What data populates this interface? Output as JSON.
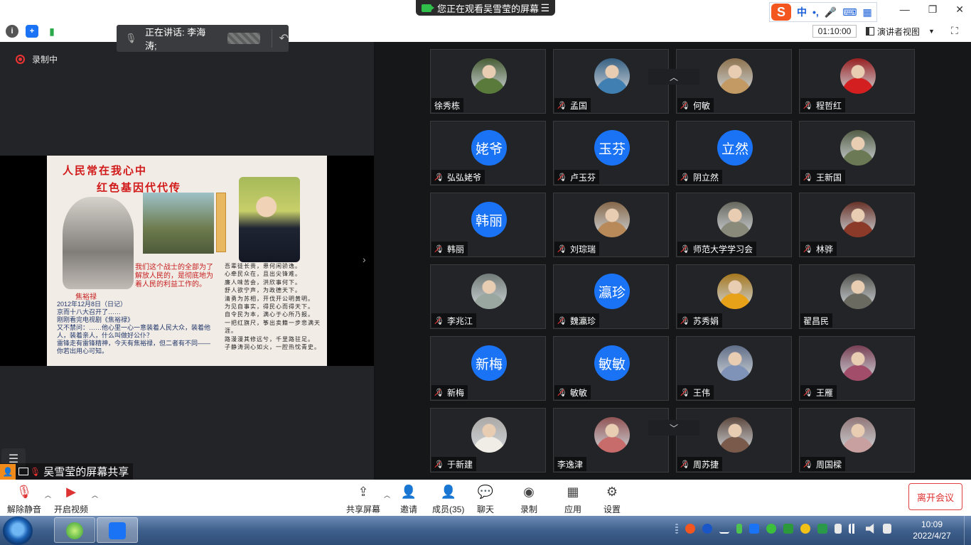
{
  "top": {
    "share_banner": "您正在观看吴雪莹的屏幕",
    "banner_menu": "☰",
    "speaking_label": "正在讲话: 李海涛;",
    "timer": "01:10:00",
    "presenter_view": "演讲者视图",
    "ime_label": "中",
    "win_min": "—",
    "win_restore": "❐",
    "win_close": "✕"
  },
  "left": {
    "recording": "录制中",
    "share_label": "吴雪莹的屏幕共享",
    "slide": {
      "title1": "人民常在我心中",
      "title2": "红色基因代代传",
      "red_text": "我们这个战士的全部为了解放人民的，是彻底地为着人民的利益工作的。",
      "sign": "焦裕禄",
      "diary": "2012年12月8日（日记）\n京而十八大召开了……\n刚刚看完电视剧《焦裕禄》\n又不禁问：……他心里一心一意装着人民大众，装着他人，装着亲人，什么叫做好公仆？\n雷锋走有雷锋精神，今天有焦裕禄，但二者有不同——你若出用心可知。",
      "poem": "吾辈徒长贵，患何闲骄逸。\n心牵民众在，且出尖锋难。\n廉人味苦会，洪欣事何下。\n舒人欲宁声，为政德天下。\n清勇为苏相，开伐开公明黄明。\n为见自事实，得民心而得天下。\n自令民为本，满心于心所乃报。\n一把红旗尺，筝出卖籍一步悲满天涯。\n路漫漫其修远兮，千里路驻足。\n子静涛洞心如火，一腔热忱青史。"
    }
  },
  "gallery": [
    {
      "name": "徐秀栋",
      "initials": "",
      "muted": false,
      "color": "#5a7a3c"
    },
    {
      "name": "孟国",
      "initials": "",
      "muted": true,
      "color": "#3f7fb2"
    },
    {
      "name": "何敏",
      "initials": "",
      "muted": true,
      "color": "#c39a63"
    },
    {
      "name": "程哲红",
      "initials": "",
      "muted": true,
      "color": "#d31f1f"
    },
    {
      "name": "弘弘姥爷",
      "initials": "姥爷",
      "muted": true,
      "color": "#1a73f5"
    },
    {
      "name": "卢玉芬",
      "initials": "玉芬",
      "muted": true,
      "color": "#1a73f5"
    },
    {
      "name": "阴立然",
      "initials": "立然",
      "muted": true,
      "color": "#1a73f5"
    },
    {
      "name": "王新国",
      "initials": "",
      "muted": true,
      "color": "#6b7a55"
    },
    {
      "name": "韩丽",
      "initials": "韩丽",
      "muted": true,
      "color": "#1a73f5"
    },
    {
      "name": "刘琮瑞",
      "initials": "",
      "muted": true,
      "color": "#b88a5a"
    },
    {
      "name": "师范大学学习会",
      "initials": "",
      "muted": true,
      "color": "#8a8a7a"
    },
    {
      "name": "林骅",
      "initials": "",
      "muted": true,
      "color": "#8b3a2a"
    },
    {
      "name": "李兆江",
      "initials": "",
      "muted": true,
      "color": "#9aa7a0"
    },
    {
      "name": "魏瀛珍",
      "initials": "瀛珍",
      "muted": true,
      "color": "#1a73f5"
    },
    {
      "name": "苏秀娟",
      "initials": "",
      "muted": true,
      "color": "#e8a21a"
    },
    {
      "name": "翟昌民",
      "initials": "",
      "muted": false,
      "color": "#6a6a60"
    },
    {
      "name": "新梅",
      "initials": "新梅",
      "muted": true,
      "color": "#1a73f5"
    },
    {
      "name": "敏敏",
      "initials": "敏敏",
      "muted": true,
      "color": "#1a73f5"
    },
    {
      "name": "王伟",
      "initials": "",
      "muted": true,
      "color": "#7f93b8"
    },
    {
      "name": "王雁",
      "initials": "",
      "muted": true,
      "color": "#a24d6a"
    },
    {
      "name": "于新建",
      "initials": "",
      "muted": true,
      "color": "#f0ece6"
    },
    {
      "name": "李逸津",
      "initials": "",
      "muted": false,
      "color": "#c86b6b"
    },
    {
      "name": "周苏捷",
      "initials": "",
      "muted": true,
      "color": "#7a5a4a"
    },
    {
      "name": "周国樑",
      "initials": "",
      "muted": true,
      "color": "#c9a0a0"
    }
  ],
  "toolbar": {
    "unmute": "解除静音",
    "start_video": "开启视频",
    "share_screen": "共享屏幕",
    "invite": "邀请",
    "members": "成员(35)",
    "chat": "聊天",
    "record": "录制",
    "apps": "应用",
    "settings": "设置",
    "leave": "离开会议"
  },
  "taskbar": {
    "time": "10:09",
    "date": "2022/4/27"
  }
}
